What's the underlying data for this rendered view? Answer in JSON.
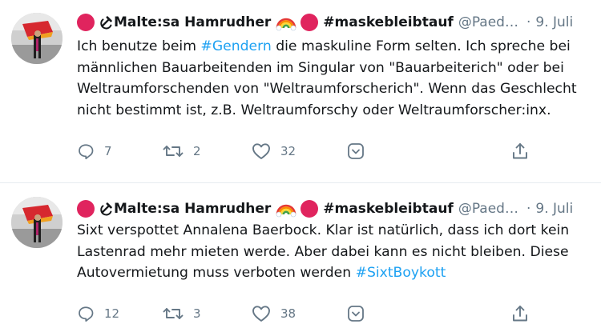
{
  "tweets": [
    {
      "author": {
        "name": "Malte:sa Hamrudher",
        "hashtag_name": "#maskebleibtauf",
        "handle": "@Paed…",
        "separator": "·"
      },
      "date": "9. Juli",
      "text_segments": [
        "Ich benutze beim ",
        "#Gendern",
        " die maskuline Form selten. Ich spreche bei männlichen Bauarbeitenden im Singular von \"Bauarbeiterich\" oder bei Weltraumforschenden von \"Weltraumforscherich\". Wenn das Geschlecht nicht bestimmt ist, z.B. Weltraumforschy oder Weltraumforscher:inx."
      ],
      "stats": {
        "replies": "7",
        "retweets": "2",
        "likes": "32"
      }
    },
    {
      "author": {
        "name": "Malte:sa Hamrudher",
        "hashtag_name": "#maskebleibtauf",
        "handle": "@Paed…",
        "separator": "·"
      },
      "date": "9. Juli",
      "text_segments": [
        "Sixt verspottet Annalena Baerbock. Klar ist natürlich, dass ich dort kein Lastenrad mehr mieten werde. Aber dabei kann es nicht bleiben. Diese Autovermietung muss verboten werden ",
        "#SixtBoykott"
      ],
      "stats": {
        "replies": "12",
        "retweets": "3",
        "likes": "38"
      }
    }
  ],
  "colors": {
    "text": "#14171a",
    "secondary": "#657786",
    "link": "#1da1f2",
    "red_circle": "#e0245e",
    "divider": "#e6ecf0"
  },
  "icons": [
    "red-circle-icon",
    "hammer-sickle-icon",
    "rainbow-icon",
    "reply-icon",
    "retweet-icon",
    "like-icon",
    "chevron-menu-icon",
    "share-icon"
  ]
}
